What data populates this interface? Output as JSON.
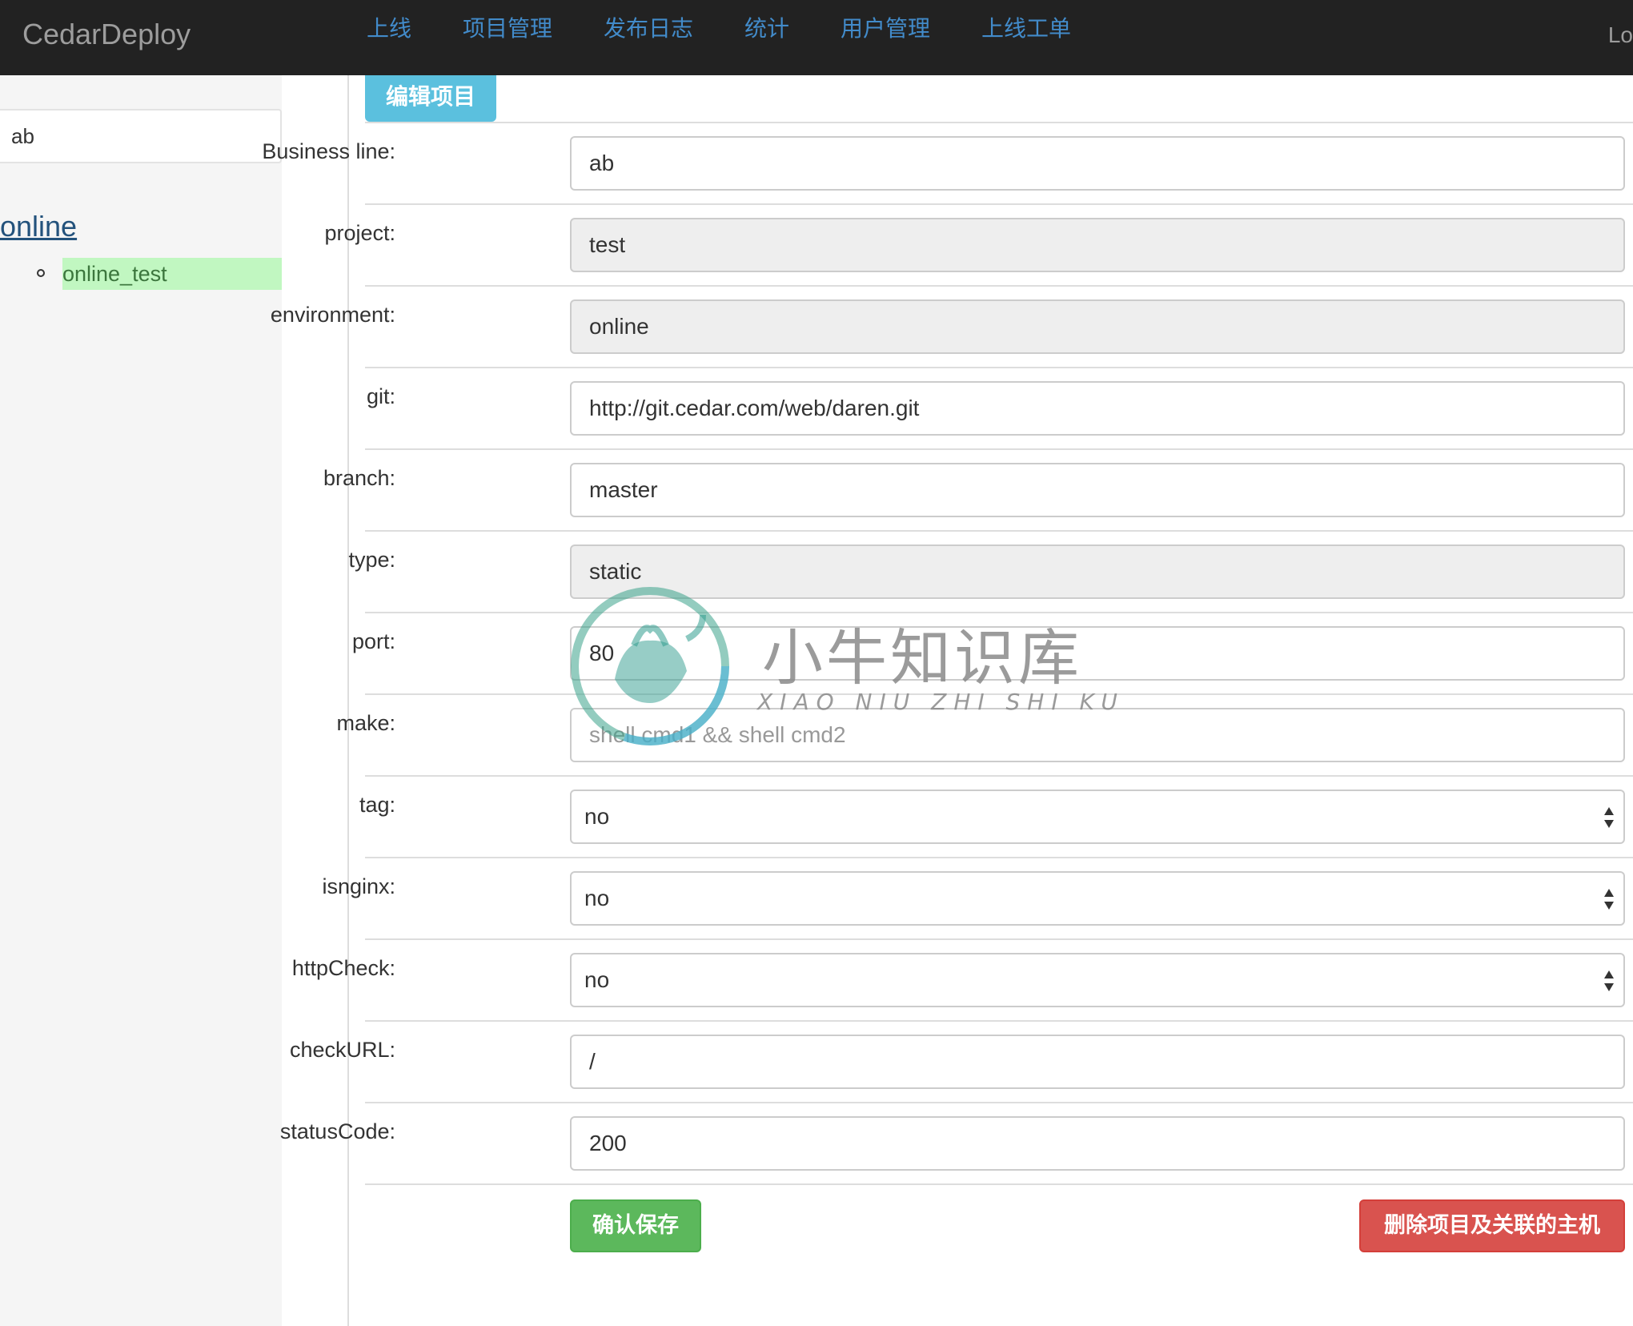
{
  "navbar": {
    "brand": "CedarDeploy",
    "items": [
      "上线",
      "项目管理",
      "发布日志",
      "统计",
      "用户管理",
      "上线工单"
    ],
    "right_text": "Lo"
  },
  "sidebar": {
    "search_value": "ab",
    "environment": "online",
    "project": "online_test"
  },
  "tab": {
    "label": "编辑项目"
  },
  "form": {
    "rows": [
      {
        "label": "Business line:",
        "value": "ab",
        "kind": "input"
      },
      {
        "label": "project:",
        "value": "test",
        "kind": "readonly"
      },
      {
        "label": "environment:",
        "value": "online",
        "kind": "readonly"
      },
      {
        "label": "git:",
        "value": "http://git.cedar.com/web/daren.git",
        "kind": "input"
      },
      {
        "label": "branch:",
        "value": "master",
        "kind": "input"
      },
      {
        "label": "type:",
        "value": "static",
        "kind": "readonly"
      },
      {
        "label": "port:",
        "value": "80",
        "kind": "input"
      },
      {
        "label": "make:",
        "value": "shell cmd1  && shell cmd2",
        "kind": "placeholder"
      },
      {
        "label": "tag:",
        "value": "no",
        "kind": "select"
      },
      {
        "label": "isnginx:",
        "value": "no",
        "kind": "select"
      },
      {
        "label": "httpCheck:",
        "value": "no",
        "kind": "select"
      },
      {
        "label": "checkURL:",
        "value": "/",
        "kind": "input"
      },
      {
        "label": "statusCode:",
        "value": "200",
        "kind": "input"
      }
    ]
  },
  "buttons": {
    "save": "确认保存",
    "delete": "删除项目及关联的主机"
  },
  "watermark": {
    "text": "小牛知识库",
    "sub": "XIAO NIU ZHI SHI KU"
  },
  "colors": {
    "navbar_bg": "#222222",
    "nav_link": "#428bca",
    "tab": "#5bc0de",
    "save": "#5cb85c",
    "delete": "#d9534f",
    "highlight": "#c1f7c1"
  }
}
